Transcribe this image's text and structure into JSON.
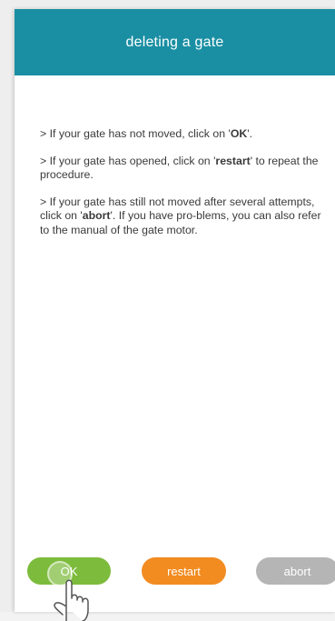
{
  "header": {
    "title": "deleting a gate"
  },
  "instructions": [
    {
      "parts": [
        {
          "text": "> If your gate has not moved, click on '",
          "bold": false
        },
        {
          "text": "OK",
          "bold": true
        },
        {
          "text": "'.",
          "bold": false
        }
      ]
    },
    {
      "parts": [
        {
          "text": "> If your gate has opened, click on '",
          "bold": false
        },
        {
          "text": "restart",
          "bold": true
        },
        {
          "text": "' to repeat the procedure.",
          "bold": false
        }
      ]
    },
    {
      "parts": [
        {
          "text": "> If your gate has still not moved after several attempts, click on '",
          "bold": false
        },
        {
          "text": "abort",
          "bold": true
        },
        {
          "text": "'. If you have pro-blems, you can also refer to the manual of the gate motor.",
          "bold": false
        }
      ]
    }
  ],
  "buttons": {
    "ok": "OK",
    "restart": "restart",
    "abort": "abort"
  },
  "colors": {
    "header": "#1a8fa3",
    "ok": "#7dbb3c",
    "restart": "#f28b20",
    "abort": "#b5b5b5"
  },
  "icons": {
    "pointer": "hand-pointer-icon"
  }
}
